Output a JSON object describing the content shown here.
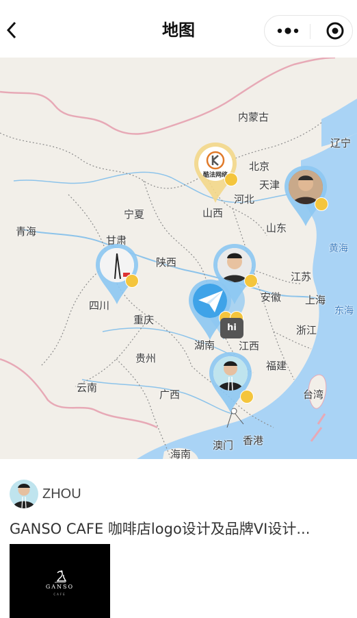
{
  "nav": {
    "title": "地图",
    "back_icon": "chevron-left-icon",
    "more_icon": "more-dots-icon",
    "close_icon": "target-close-icon"
  },
  "map": {
    "provinces": [
      "内蒙古",
      "辽宁",
      "北京",
      "天津",
      "河北",
      "山西",
      "宁夏",
      "青海",
      "甘肃",
      "陕西",
      "山东",
      "黄海",
      "江苏",
      "四川",
      "安徽",
      "上海",
      "东海",
      "重庆",
      "湖南",
      "江西",
      "浙江",
      "贵州",
      "福建",
      "云南",
      "广西",
      "台湾",
      "澳门",
      "香港",
      "海南"
    ],
    "cluster_label": "hi",
    "marker_colors": {
      "pin": "#8cc7f2",
      "pin_alt": "#f3d78a",
      "dot": "#f4c53d"
    },
    "brand_logo_text": "酷法网络"
  },
  "post": {
    "author": "ZHOU",
    "title": "GANSO CAFE 咖啡店logo设计及品牌VI设计...",
    "thumb_brand": "GANSO",
    "thumb_sub": "CAFE"
  }
}
